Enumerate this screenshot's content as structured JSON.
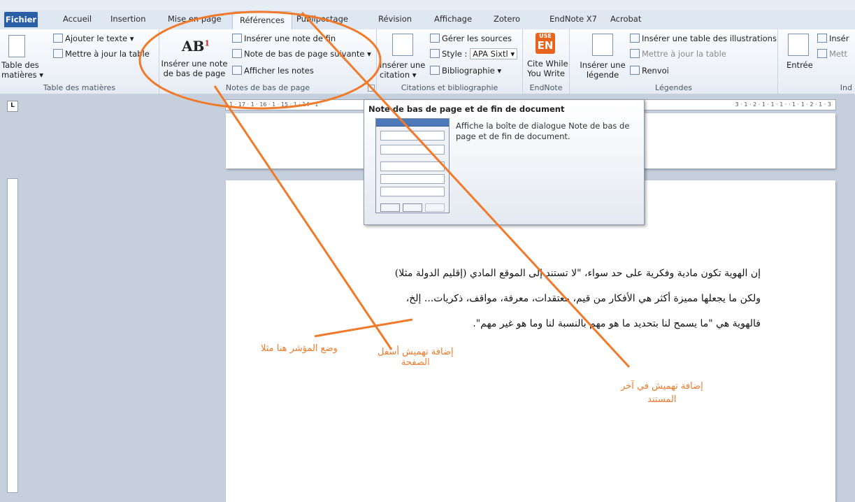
{
  "ribbon_tabs": [
    "Fichier",
    "Accueil",
    "Insertion",
    "Mise en page",
    "Références",
    "Publipostage",
    "Révision",
    "Affichage",
    "Zotero",
    "EndNote X7",
    "Acrobat"
  ],
  "active_tab": "Références",
  "groups": {
    "toc": {
      "label": "Table des matières",
      "big_button": [
        "Table des",
        "matières ▾"
      ],
      "add_text": "Ajouter le texte ▾",
      "update_table": "Mettre à jour la table"
    },
    "footnotes": {
      "label": "Notes de bas de page",
      "insert_footnote": [
        "Insérer une note",
        "de bas de page"
      ],
      "insert_endnote": "Insérer une note de fin",
      "next_footnote": "Note de bas de page suivante ▾",
      "show_notes": "Afficher les notes"
    },
    "citations": {
      "label": "Citations et bibliographie",
      "insert_citation": [
        "Insérer une",
        "citation ▾"
      ],
      "manage_sources": "Gérer les sources",
      "style_label": "Style :",
      "style_value": "APA Sixtl ▾",
      "bibliography": "Bibliographie ▾"
    },
    "endnote": {
      "label": "EndNote",
      "cite_while": [
        "Cite While",
        "You Write"
      ],
      "logo_top": "USE",
      "logo_main": "EN"
    },
    "captions": {
      "label": "Légendes",
      "insert_caption": [
        "Insérer une",
        "légende"
      ],
      "insert_table_fig": "Insérer une table des illustrations",
      "update_table": "Mettre à jour la table",
      "cross_ref": "Renvoi"
    },
    "index": {
      "label": "Ind",
      "entry": "Entrée",
      "insert": "Insér",
      "update": "Mett"
    }
  },
  "ruler_corner": "L",
  "hruler_text": "· 1 · 17 · 1 · 16 · 1 · 15 · 1 · 14 · 1 ·",
  "hruler_text_right": "3 · 1 · 2 · 1 · 1 · 1 · · 1 · 1 · 2 · 1 · 3",
  "tooltip": {
    "title": "Note de bas de page et de fin de document",
    "description": "Affiche la boîte de dialogue Note de bas de page et de fin de document."
  },
  "document_paragraphs": [
    "إن الهوية تكون مادية وفكرية على حد سواء، \"لا تستند إلى الموقع المادي (إقليم الدولة مثلا)",
    "ولكن ما يجعلها مميزة أكثر هي الأفكار من قيم، معتقدات، معرفة، مواقف، ذكريات... إلخ،",
    "فالهوية هي \"ما يسمح لنا بتحديد ما هو مهم بالنسبة لنا وما هو غير مهم\"."
  ],
  "annotations": {
    "cursor": "وضع المؤشر هنا مثلا",
    "footnote_line1": "إضافة تهميش أسفل",
    "footnote_line2": "الصفحة",
    "endnote_line1": "إضافة تهميش في آخر",
    "endnote_line2": "المستند"
  },
  "annotation_color": "#f07a2a"
}
